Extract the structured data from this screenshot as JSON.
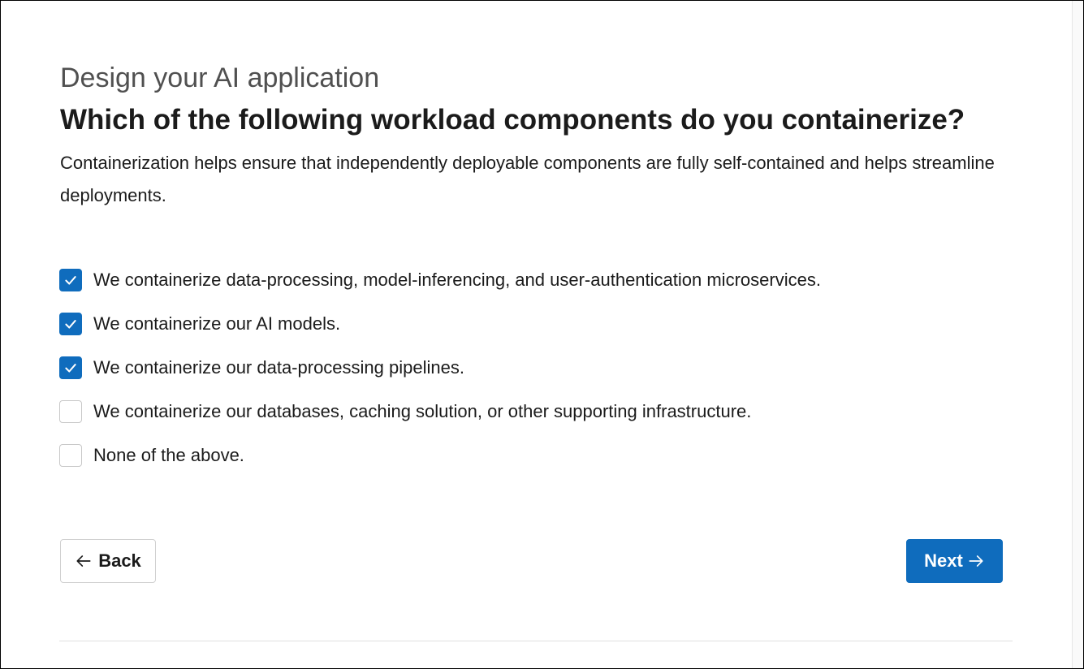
{
  "header": {
    "eyebrow": "Design your AI application",
    "question": "Which of the following workload components do you containerize?",
    "description": "Containerization helps ensure that independently deployable components are fully self-contained and helps streamline deployments."
  },
  "options": [
    {
      "label": "We containerize data-processing, model-inferencing, and user-authentication microservices.",
      "checked": true
    },
    {
      "label": "We containerize our AI models.",
      "checked": true
    },
    {
      "label": "We containerize our data-processing pipelines.",
      "checked": true
    },
    {
      "label": "We containerize our databases, caching solution, or other supporting infrastructure.",
      "checked": false
    },
    {
      "label": "None of the above.",
      "checked": false
    }
  ],
  "navigation": {
    "back_label": "Back",
    "back_icon": "arrow-left-icon",
    "next_label": "Next",
    "next_icon": "arrow-right-icon"
  },
  "colors": {
    "accent": "#0f6cbd",
    "text": "#1b1b1b",
    "eyebrow_text": "#505050",
    "border": "#d1d1d1"
  }
}
